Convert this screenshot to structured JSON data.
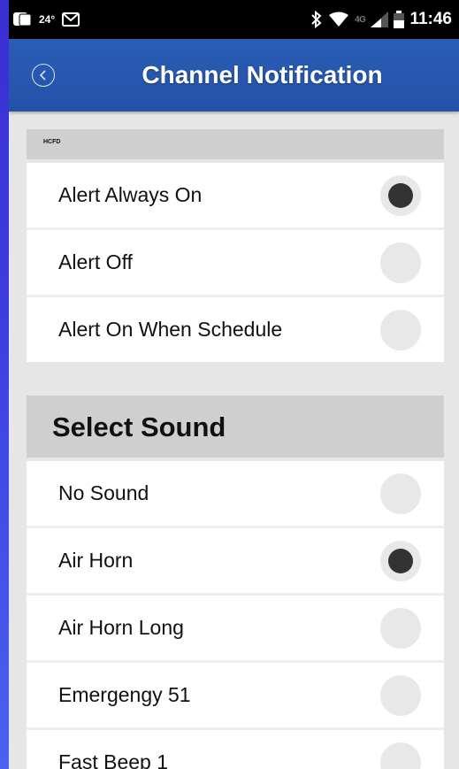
{
  "status_bar": {
    "temperature": "24°",
    "network": "4G",
    "time": "11:46",
    "icons": [
      "app-notification-icon",
      "gmail-icon",
      "bluetooth-icon",
      "wifi-icon",
      "signal-icon",
      "battery-icon"
    ]
  },
  "app_bar": {
    "title": "Channel Notification",
    "back_icon": "chevron-left-icon"
  },
  "alert_section": {
    "header": "HCFD",
    "options": [
      {
        "label": "Alert Always On",
        "selected": true
      },
      {
        "label": "Alert Off",
        "selected": false
      },
      {
        "label": "Alert On When Schedule",
        "selected": false
      }
    ]
  },
  "sound_section": {
    "header": "Select Sound",
    "options": [
      {
        "label": "No Sound",
        "selected": false
      },
      {
        "label": "Air Horn",
        "selected": true
      },
      {
        "label": "Air Horn Long",
        "selected": false
      },
      {
        "label": "Emergengy 51",
        "selected": false
      },
      {
        "label": "Fast Beep 1",
        "selected": false
      }
    ]
  },
  "colors": {
    "app_bar": "#2a5db6",
    "radio_selected": "#333333",
    "radio_unselected": "#e8e8e8",
    "section_header": "#cfcfcf",
    "background": "#e6e6e6"
  }
}
